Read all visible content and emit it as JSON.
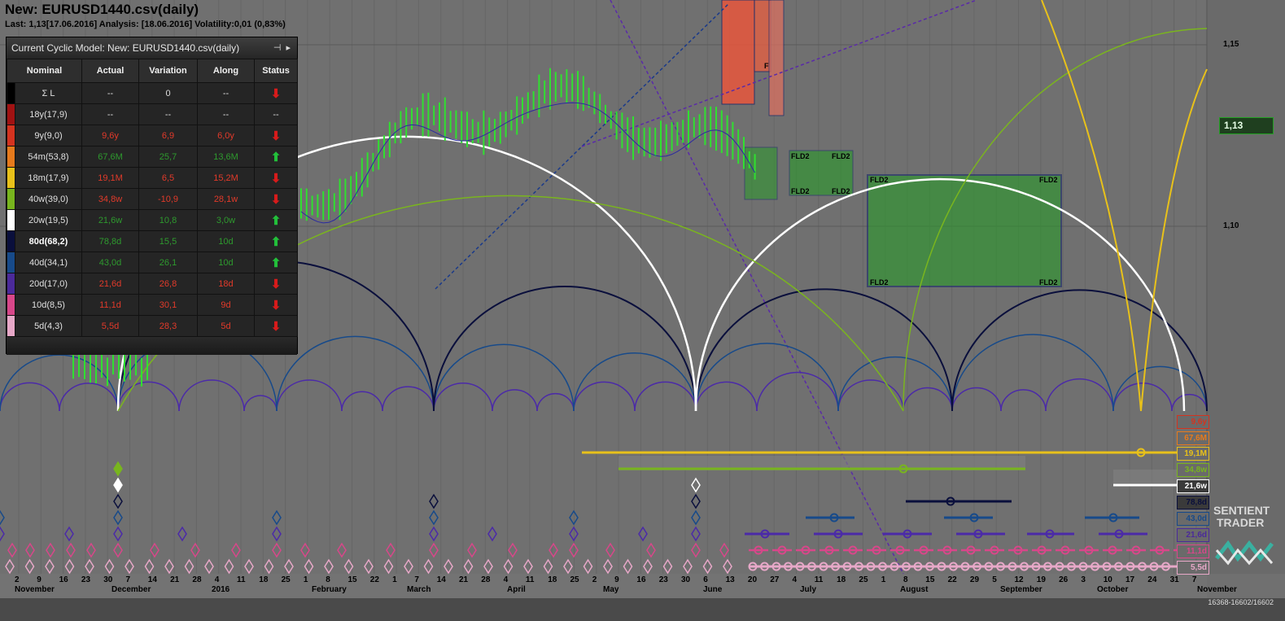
{
  "header": {
    "title": "New: EURUSD1440.csv(daily)",
    "subtitle": "Last: 1,13[17.06.2016] Analysis: [18.06.2016] Volatility:0,01 (0,83%)"
  },
  "panel": {
    "title": "Current Cyclic Model: New: EURUSD1440.csv(daily)",
    "columns": [
      "Nominal",
      "Actual",
      "Variation",
      "Along",
      "Status"
    ],
    "rows": [
      {
        "swatch": "#000000",
        "nominal": "Σ L",
        "actual": "--",
        "variation": "0",
        "along": "--",
        "status": "down",
        "color": "#ddd"
      },
      {
        "swatch": "#a11212",
        "nominal": "18y(17,9)",
        "actual": "--",
        "variation": "--",
        "along": "--",
        "status": "none",
        "color": "#ddd"
      },
      {
        "swatch": "#d4331f",
        "nominal": "9y(9,0)",
        "actual": "9,6y",
        "variation": "6,9",
        "along": "6,0y",
        "status": "down",
        "color": "#e23a2a"
      },
      {
        "swatch": "#e67a1c",
        "nominal": "54m(53,8)",
        "actual": "67,6M",
        "variation": "25,7",
        "along": "13,6M",
        "status": "up",
        "color": "#2e9a2e"
      },
      {
        "swatch": "#e8c11a",
        "nominal": "18m(17,9)",
        "actual": "19,1M",
        "variation": "6,5",
        "along": "15,2M",
        "status": "down",
        "color": "#e23a2a"
      },
      {
        "swatch": "#78b51e",
        "nominal": "40w(39,0)",
        "actual": "34,8w",
        "variation": "-10,9",
        "along": "28,1w",
        "status": "down",
        "color": "#e23a2a"
      },
      {
        "swatch": "#ffffff",
        "nominal": "20w(19,5)",
        "actual": "21,6w",
        "variation": "10,8",
        "along": "3,0w",
        "status": "up",
        "color": "#2e9a2e"
      },
      {
        "swatch": "#0a0f3c",
        "nominal": "80d(68,2)",
        "actual": "78,8d",
        "variation": "15,5",
        "along": "10d",
        "status": "up",
        "color": "#2e9a2e"
      },
      {
        "swatch": "#174a8a",
        "nominal": "40d(34,1)",
        "actual": "43,0d",
        "variation": "26,1",
        "along": "10d",
        "status": "up",
        "color": "#2e9a2e"
      },
      {
        "swatch": "#4b2a9a",
        "nominal": "20d(17,0)",
        "actual": "21,6d",
        "variation": "26,8",
        "along": "18d",
        "status": "down",
        "color": "#e23a2a"
      },
      {
        "swatch": "#d8478a",
        "nominal": "10d(8,5)",
        "actual": "11,1d",
        "variation": "30,1",
        "along": "9d",
        "status": "down",
        "color": "#e23a2a"
      },
      {
        "swatch": "#e7a8c8",
        "nominal": "5d(4,3)",
        "actual": "5,5d",
        "variation": "28,3",
        "along": "5d",
        "status": "down",
        "color": "#e23a2a"
      }
    ],
    "status_glyphs": {
      "up": "⬆",
      "down": "⬇",
      "none": "--"
    }
  },
  "price_axis": {
    "current": "1,13",
    "ticks": [
      {
        "label": "1,15",
        "value": 1.15
      },
      {
        "label": "1,10",
        "value": 1.1
      }
    ]
  },
  "cycle_labels": [
    {
      "text": "9,6y",
      "color": "#d4331f"
    },
    {
      "text": "67,6M",
      "color": "#e67a1c"
    },
    {
      "text": "19,1M",
      "color": "#e8c11a"
    },
    {
      "text": "34,8w",
      "color": "#78b51e"
    },
    {
      "text": "21,6w",
      "color": "#ffffff"
    },
    {
      "text": "78,8d",
      "color": "#0a0f3c"
    },
    {
      "text": "43,0d",
      "color": "#174a8a"
    },
    {
      "text": "21,6d",
      "color": "#4b2a9a"
    },
    {
      "text": "11,1d",
      "color": "#d8478a"
    },
    {
      "text": "5,5d",
      "color": "#e7a8c8"
    }
  ],
  "fld_labels": [
    "FLD2",
    "FLD2",
    "FLD2",
    "FLD2",
    "FLD2",
    "FLD2",
    "FLD2",
    "FLD2",
    "F"
  ],
  "time_axis": {
    "days": [
      "2",
      "9",
      "16",
      "23",
      "30",
      "7",
      "14",
      "21",
      "28",
      "4",
      "11",
      "18",
      "25",
      "1",
      "8",
      "15",
      "22",
      "1",
      "7",
      "14",
      "21",
      "28",
      "4",
      "11",
      "18",
      "25",
      "2",
      "9",
      "16",
      "23",
      "30",
      "6",
      "13",
      "20",
      "27",
      "4",
      "11",
      "18",
      "25",
      "1",
      "8",
      "15",
      "22",
      "29",
      "5",
      "12",
      "19",
      "26",
      "3",
      "10",
      "17",
      "24",
      "31",
      "7"
    ],
    "months": [
      {
        "label": "November"
      },
      {
        "label": "December"
      },
      {
        "label": "2016"
      },
      {
        "label": "February"
      },
      {
        "label": "March"
      },
      {
        "label": "April"
      },
      {
        "label": "May"
      },
      {
        "label": "June"
      },
      {
        "label": "July"
      },
      {
        "label": "August"
      },
      {
        "label": "September"
      },
      {
        "label": "October"
      },
      {
        "label": "November"
      }
    ]
  },
  "footer": {
    "range": "16368-16602/16602"
  },
  "logo": {
    "line1": "SENTIENT",
    "line2": "TRADER"
  }
}
